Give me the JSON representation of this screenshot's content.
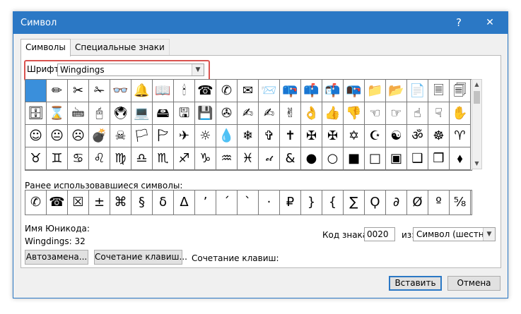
{
  "window": {
    "title": "Символ",
    "help_glyph": "?",
    "close_glyph": "✕"
  },
  "tabs": [
    {
      "label": "Символы"
    },
    {
      "label": "Специальные знаки"
    }
  ],
  "font": {
    "label": "Шрифт:",
    "value": "Wingdings"
  },
  "grid": {
    "rows": [
      [
        " ",
        "✏",
        "✂",
        "✁",
        "👓",
        "🔔",
        "📖",
        "🕯",
        "☎",
        "✆",
        "✉",
        "📨",
        "📪",
        "📫",
        "📬",
        "📭",
        "📁",
        "📂",
        "📄",
        "🗏",
        "🗐"
      ],
      [
        "🗄",
        "⌛",
        "🖮",
        "🖰",
        "🖲",
        "💻",
        "🖴",
        "🖫",
        "💾",
        "✇",
        "✍",
        "✍",
        "✌",
        "👌",
        "👍",
        "👎",
        "☜",
        "☞",
        "☝",
        "☟",
        "✋"
      ],
      [
        "☺",
        "😐",
        "☹",
        "💣",
        "☠",
        "🏳",
        "🏱",
        "✈",
        "☼",
        "💧",
        "❄",
        "✞",
        "✝",
        "✠",
        "✠",
        "✡",
        "☪",
        "☯",
        "ॐ",
        "☸",
        "♈"
      ],
      [
        "♉",
        "♊",
        "♋",
        "♌",
        "♍",
        "♎",
        "♏",
        "♐",
        "♑",
        "♒",
        "♓",
        "𝓮𝓽",
        "&",
        "●",
        "○",
        "■",
        "□",
        "▣",
        "❑",
        "❒",
        "⬧"
      ]
    ]
  },
  "recent": {
    "label": "Ранее использовавшиеся символы:",
    "items": [
      "✆",
      "☎",
      "☒",
      "±",
      "⌘",
      "§",
      "δ",
      "Δ",
      "’",
      "´",
      "`",
      "·",
      "₽",
      "}",
      "{",
      "∑",
      "Ϙ",
      "∂",
      "Ø",
      "º",
      "⅝"
    ]
  },
  "unicode_name": {
    "label": "Имя Юникода:",
    "value": "Wingdings: 32"
  },
  "code": {
    "label": "Код знака:",
    "value": "0020",
    "from_label": "из:",
    "from_value": "Символ (шестн.)"
  },
  "buttons": {
    "autocorrect": "Автозамена...",
    "shortcut_key": "Сочетание клавиш...",
    "shortcut_label": "Сочетание клавиш:",
    "insert": "Вставить",
    "cancel": "Отмена"
  }
}
